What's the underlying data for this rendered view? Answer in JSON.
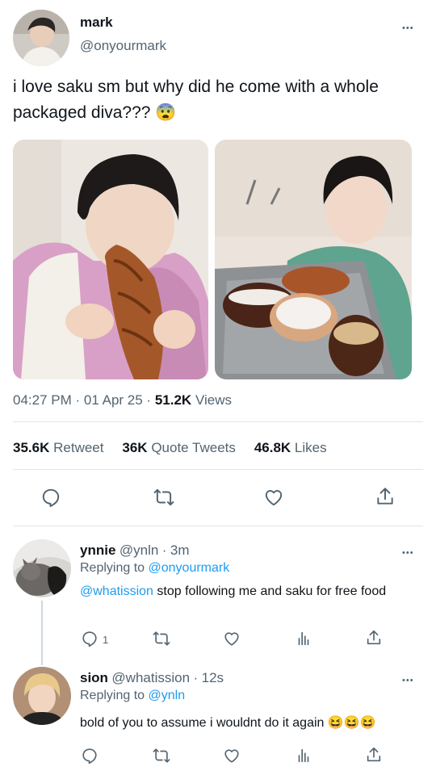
{
  "tweet": {
    "author_name": "mark",
    "author_handle": "@onyourmark",
    "more_label": "•••",
    "text": "i love saku sm but why did he come with a whole packaged diva??? 😨",
    "time": "04:27 PM",
    "date": "01 Apr 25",
    "views_count": "51.2K",
    "views_label": "Views",
    "separator": "·",
    "stats": {
      "retweets_count": "35.6K",
      "retweets_label": "Retweet",
      "quotes_count": "36K",
      "quotes_label": "Quote Tweets",
      "likes_count": "46.8K",
      "likes_label": "Likes"
    }
  },
  "replies": [
    {
      "name": "ynnie",
      "handle": "@ynln",
      "time": "3m",
      "replying_prefix": "Replying to",
      "replying_to": "@onyourmark",
      "mention": "@whatission",
      "text": "stop following me and saku for free food",
      "reply_count": "1"
    },
    {
      "name": "sion",
      "handle": "@whatission",
      "time": "12s",
      "replying_prefix": "Replying to",
      "replying_to": "@ynln",
      "text": "bold of you to assume i wouldnt do it again 😆😆😆"
    }
  ],
  "icons": {
    "reply": "reply-icon",
    "retweet": "retweet-icon",
    "like": "heart-icon",
    "analytics": "analytics-icon",
    "share": "share-icon"
  },
  "colors": {
    "text": "#0f1419",
    "secondary": "#536471",
    "link": "#1d9bf0",
    "divider": "#e1e4e8"
  }
}
